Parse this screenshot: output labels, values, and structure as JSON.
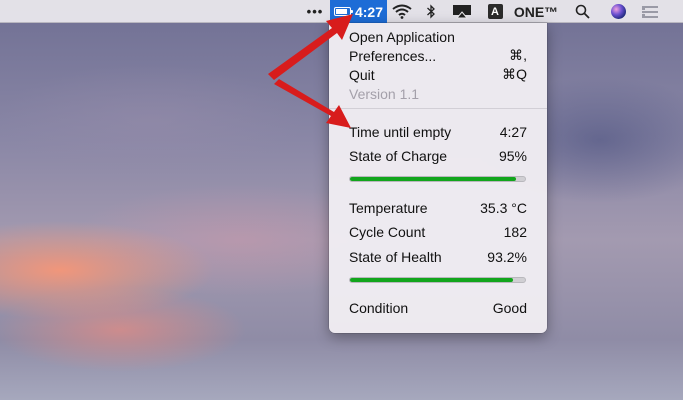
{
  "menubar": {
    "dots": "•••",
    "battery_time": "4:27",
    "battery_level": 0.95,
    "input_source": "A",
    "app_name": "ONE™",
    "icons": [
      "more-dots-icon",
      "battery-icon",
      "wifi-icon",
      "bluetooth-icon",
      "airplay-icon",
      "input-source-icon",
      "search-icon",
      "siri-icon",
      "notification-list-icon"
    ]
  },
  "menu": {
    "open_application": "Open Application",
    "preferences": "Preferences...",
    "preferences_shortcut": "⌘,",
    "quit": "Quit",
    "quit_shortcut": "⌘Q",
    "version": "Version 1.1",
    "time_until_empty_label": "Time until empty",
    "time_until_empty_value": "4:27",
    "state_of_charge_label": "State of Charge",
    "state_of_charge_value": "95%",
    "state_of_charge_fraction": 0.95,
    "temperature_label": "Temperature",
    "temperature_value": "35.3 °C",
    "cycle_count_label": "Cycle Count",
    "cycle_count_value": "182",
    "state_of_health_label": "State of Health",
    "state_of_health_value": "93.2%",
    "state_of_health_fraction": 0.932,
    "condition_label": "Condition",
    "condition_value": "Good"
  },
  "colors": {
    "menubar_highlight": "#1d6cd6",
    "progress_fill": "#12a51c",
    "arrow": "#d81c1c"
  }
}
